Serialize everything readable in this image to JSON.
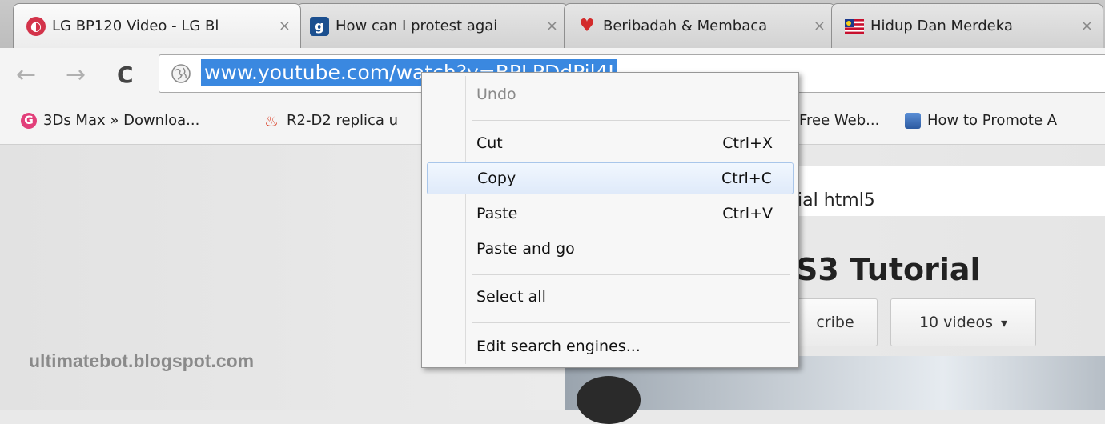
{
  "tabs": [
    {
      "title": "LG BP120 Video - LG Bl",
      "favicon": "lg-logo-icon",
      "color": "#d3334a"
    },
    {
      "title": "How can I protest agai",
      "favicon": "guardian-g-icon",
      "color": "#1b4f8f"
    },
    {
      "title": "Beribadah & Membaca",
      "favicon": "heart-luv-icon",
      "color": "#d32b2b"
    },
    {
      "title": "Hidup Dan Merdeka",
      "favicon": "malaysia-flag-icon",
      "color": "#c8102e"
    }
  ],
  "tab_close_glyph": "×",
  "toolbar": {
    "back_icon": "←",
    "forward_icon": "→",
    "reload_icon": "C",
    "url": "www.youtube.com/watch?v=BPLPDdPil4I"
  },
  "bookmarks": [
    {
      "label": "3Ds Max » Downloa...",
      "icon": "g-circle-icon"
    },
    {
      "label": "R2-D2 replica u",
      "icon": "fire-icon"
    },
    {
      "label": "Free Web...",
      "icon": "web-icon"
    },
    {
      "label": "How to Promote A",
      "icon": "promote-icon"
    }
  ],
  "page": {
    "search_query": "ial html5",
    "channel_title": "S3 Tutorial",
    "subscribe_label": "cribe",
    "videos_label": "10 videos",
    "videos_dropdown_glyph": "▾",
    "watermark": "ultimatebot.blogspot.com"
  },
  "context_menu": {
    "items": [
      {
        "label": "Undo",
        "shortcut": ""
      },
      {
        "label": "Cut",
        "shortcut": "Ctrl+X"
      },
      {
        "label": "Copy",
        "shortcut": "Ctrl+C"
      },
      {
        "label": "Paste",
        "shortcut": "Ctrl+V"
      },
      {
        "label": "Paste and go",
        "shortcut": ""
      },
      {
        "label": "Select all",
        "shortcut": ""
      },
      {
        "label": "Edit search engines...",
        "shortcut": ""
      }
    ]
  }
}
